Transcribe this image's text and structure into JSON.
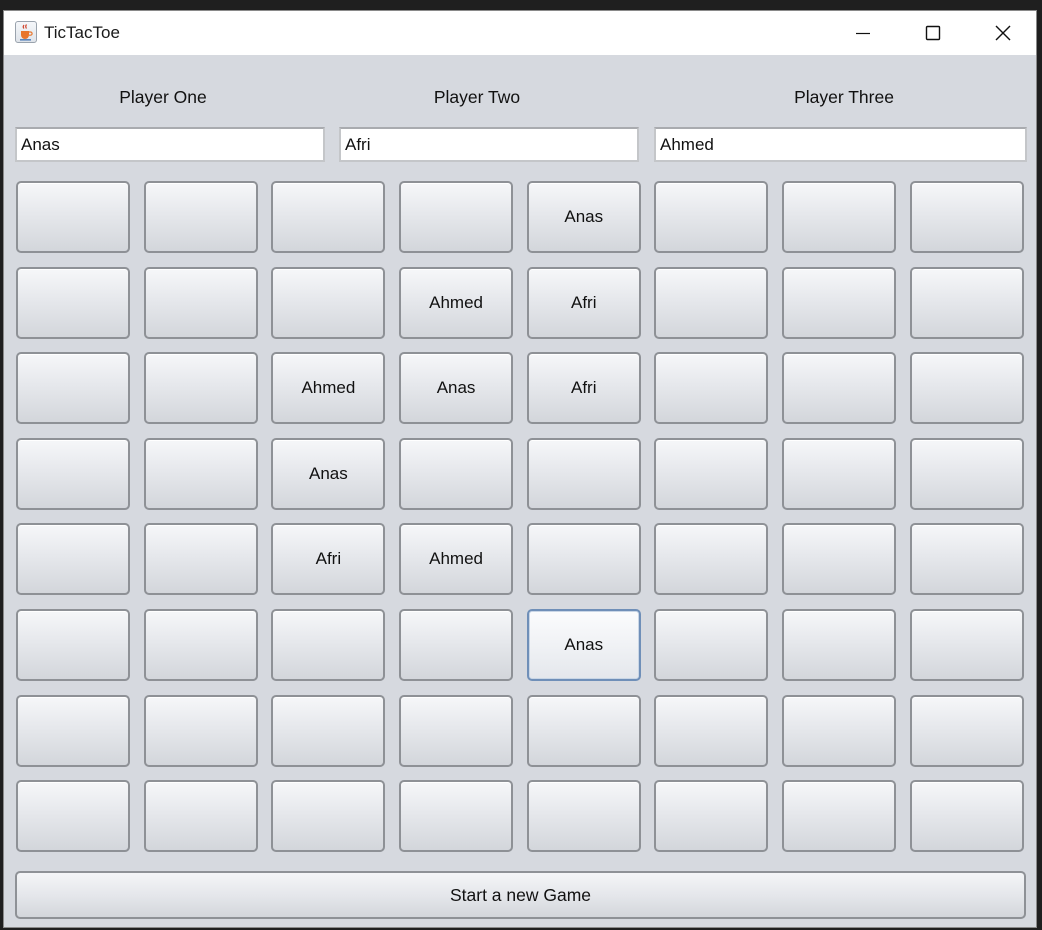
{
  "window": {
    "title": "TicTacToe",
    "icon": "java-cup-icon",
    "controls": [
      "minimize-icon",
      "maximize-icon",
      "close-icon"
    ]
  },
  "players": [
    {
      "label": "Player One",
      "name": "Anas"
    },
    {
      "label": "Player Two",
      "name": "Afri"
    },
    {
      "label": "Player Three",
      "name": "Ahmed"
    }
  ],
  "board": {
    "rows": 8,
    "cols": 8,
    "cells": [
      [
        "",
        "",
        "",
        "",
        "Anas",
        "",
        "",
        ""
      ],
      [
        "",
        "",
        "",
        "Ahmed",
        "Afri",
        "",
        "",
        ""
      ],
      [
        "",
        "",
        "Ahmed",
        "Anas",
        "Afri",
        "",
        "",
        ""
      ],
      [
        "",
        "",
        "Anas",
        "",
        "",
        "",
        "",
        ""
      ],
      [
        "",
        "",
        "Afri",
        "Ahmed",
        "",
        "",
        "",
        ""
      ],
      [
        "",
        "",
        "",
        "",
        "Anas",
        "",
        "",
        ""
      ],
      [
        "",
        "",
        "",
        "",
        "",
        "",
        "",
        ""
      ],
      [
        "",
        "",
        "",
        "",
        "",
        "",
        "",
        ""
      ]
    ],
    "focused_cell": {
      "row": 5,
      "col": 4
    }
  },
  "new_game_label": "Start a new Game"
}
